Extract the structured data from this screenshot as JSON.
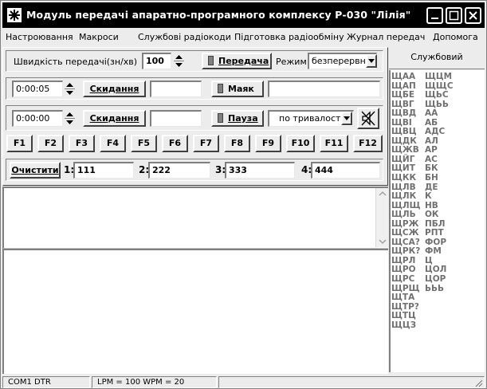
{
  "window": {
    "title": "Модуль передачі апаратно-програмного комплексу  Р-030 \"Лілія\""
  },
  "menu": {
    "items": [
      "Настроювання",
      "Макроси",
      "Службові радіокоди",
      "Підготовка радіообміну",
      "Журнал передач",
      "Допомога"
    ]
  },
  "speed": {
    "label": "Швидкість передачі(зн/хв)",
    "value": "100",
    "transmit_label": "Передача",
    "mode_label": "Режим",
    "mode_value": "безперервно"
  },
  "beacon_row": {
    "time_value": "0:00:05",
    "reset_label": "Скидання",
    "beacon_label": "Маяк",
    "left_field": "",
    "right_field": ""
  },
  "pause_row": {
    "time_value": "0:00:00",
    "reset_label": "Скидання",
    "pause_label": "Пауза",
    "left_field": "",
    "mode_value": "по тривалості"
  },
  "function_keys": [
    "F1",
    "F2",
    "F3",
    "F4",
    "F5",
    "F6",
    "F7",
    "F8",
    "F9",
    "F10",
    "F11",
    "F12"
  ],
  "memory_row": {
    "clear_label": "Очистити",
    "slots": [
      {
        "label": "1:",
        "value": "111"
      },
      {
        "label": "2:",
        "value": "222"
      },
      {
        "label": "3:",
        "value": "333"
      },
      {
        "label": "4:",
        "value": "444"
      }
    ]
  },
  "top_text": "",
  "bottom_text": "",
  "service_panel": {
    "header": "Службовий радіокод",
    "rows": [
      [
        "ЩАА",
        "ЩЦМ"
      ],
      [
        "ЩАП",
        "ЩЩС"
      ],
      [
        "ЩБЕ",
        "ЩЬС"
      ],
      [
        "ЩВГ",
        "ЩЬЬ"
      ],
      [
        "ЩВД",
        "АА"
      ],
      [
        "ЩВІ",
        "АБ"
      ],
      [
        "ЩВЦ",
        "АДС"
      ],
      [
        "ЩДК",
        "АЛ"
      ],
      [
        "ЩЖВ",
        "АР"
      ],
      [
        "ЩЙГ",
        "АС"
      ],
      [
        "ЩИТ",
        "БК"
      ],
      [
        "ЩКК",
        "БН"
      ],
      [
        "ЩЛВ",
        "ДЕ"
      ],
      [
        "ЩЛК",
        "К"
      ],
      [
        "ЩЛЩ",
        "НВ"
      ],
      [
        "ЩЛЬ",
        "ОК"
      ],
      [
        "ЩРЖ",
        "ПБЛ"
      ],
      [
        "ЩСЖ",
        "РПТ"
      ],
      [
        "ЩСА?",
        "ФОР"
      ],
      [
        "ЩРК?",
        "ФМ"
      ],
      [
        "ЩРЛ",
        "Ц"
      ],
      [
        "ЩРО",
        "ЦОЛ"
      ],
      [
        "ЩРС",
        "ЦОР"
      ],
      [
        "ЩРЩ",
        "ЬЬЬ"
      ],
      [
        "ЩТА",
        ""
      ],
      [
        "ЩТР?",
        ""
      ],
      [
        "ЩТЦ",
        ""
      ],
      [
        "ЩЦЗ",
        ""
      ]
    ]
  },
  "status": {
    "port": "COM1  DTR",
    "speed": "LPM = 100   WPM = 20"
  }
}
